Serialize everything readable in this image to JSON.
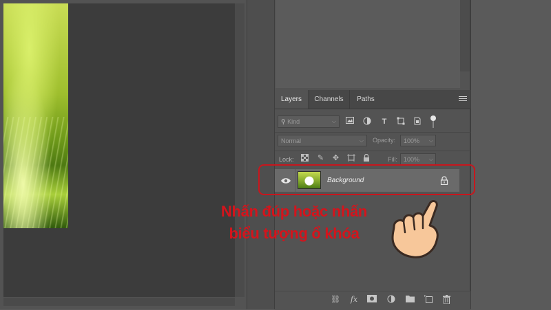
{
  "layers_panel": {
    "tabs": [
      {
        "label": "Layers"
      },
      {
        "label": "Channels"
      },
      {
        "label": "Paths"
      }
    ],
    "filter": {
      "kind_value": "Kind",
      "filter_icons": [
        "image-filter-icon",
        "adjustment-filter-icon",
        "type-filter-icon",
        "shape-filter-icon",
        "smart-object-filter-icon",
        "filter-toggle-icon"
      ]
    },
    "blend": {
      "mode_value": "Normal",
      "opacity_label": "Opacity:",
      "opacity_value": "100%"
    },
    "lock": {
      "lock_label": "Lock:",
      "fill_label": "Fill:",
      "fill_value": "100%"
    },
    "layers": [
      {
        "name": "Background",
        "visible": true,
        "locked": true
      }
    ],
    "footer_icons": [
      "link-icon",
      "fx-icon",
      "mask-icon",
      "adjustment-icon",
      "folder-icon",
      "new-layer-icon",
      "trash-icon"
    ]
  },
  "annotation": {
    "line1": "Nhấn đúp hoặc nhấn",
    "line2": "biểu tượng ổ khóa",
    "color": "#d4141c",
    "highlight_color": "#c8161d"
  }
}
